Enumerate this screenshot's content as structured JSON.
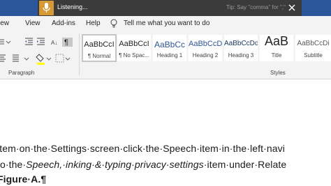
{
  "dictation": {
    "status": "Listening...",
    "tip": "Tip: Say \"comma\" for \",\""
  },
  "menu": {
    "items": [
      "View",
      "Add-ins",
      "Help"
    ],
    "cut_item": "iew",
    "tell_me": "Tell me what you want to do"
  },
  "ribbon": {
    "paragraph_label": "Paragraph",
    "styles_label": "Styles",
    "styles": [
      {
        "sample": "AaBbCcI",
        "name": "¶ Normal"
      },
      {
        "sample": "AaBbCcI",
        "name": "¶ No Spac..."
      },
      {
        "sample": "AaBbCc",
        "name": "Heading 1"
      },
      {
        "sample": "AaBbCcD",
        "name": "Heading 2"
      },
      {
        "sample": "AaBbCcDd",
        "name": "Heading 3"
      },
      {
        "sample": "AaB",
        "name": "Title"
      },
      {
        "sample": "AaBbCcDi",
        "name": "Subtitle"
      }
    ]
  },
  "document": {
    "line1": "item·on·the·Settings·screen·click·the·Speech·item·in·the·left·navi",
    "line2_a": "to·the·",
    "line2_b": "Speech,·inking·&·typing·privacy·settings",
    "line2_c": "·item·under·Relate",
    "line3": "Figure·A.¶"
  },
  "colors": {
    "title_blue": "#2b579a",
    "dictation_bg": "#3b3b3b",
    "mic_orange": "#d59a36",
    "heading_blue": "#2f5496"
  }
}
